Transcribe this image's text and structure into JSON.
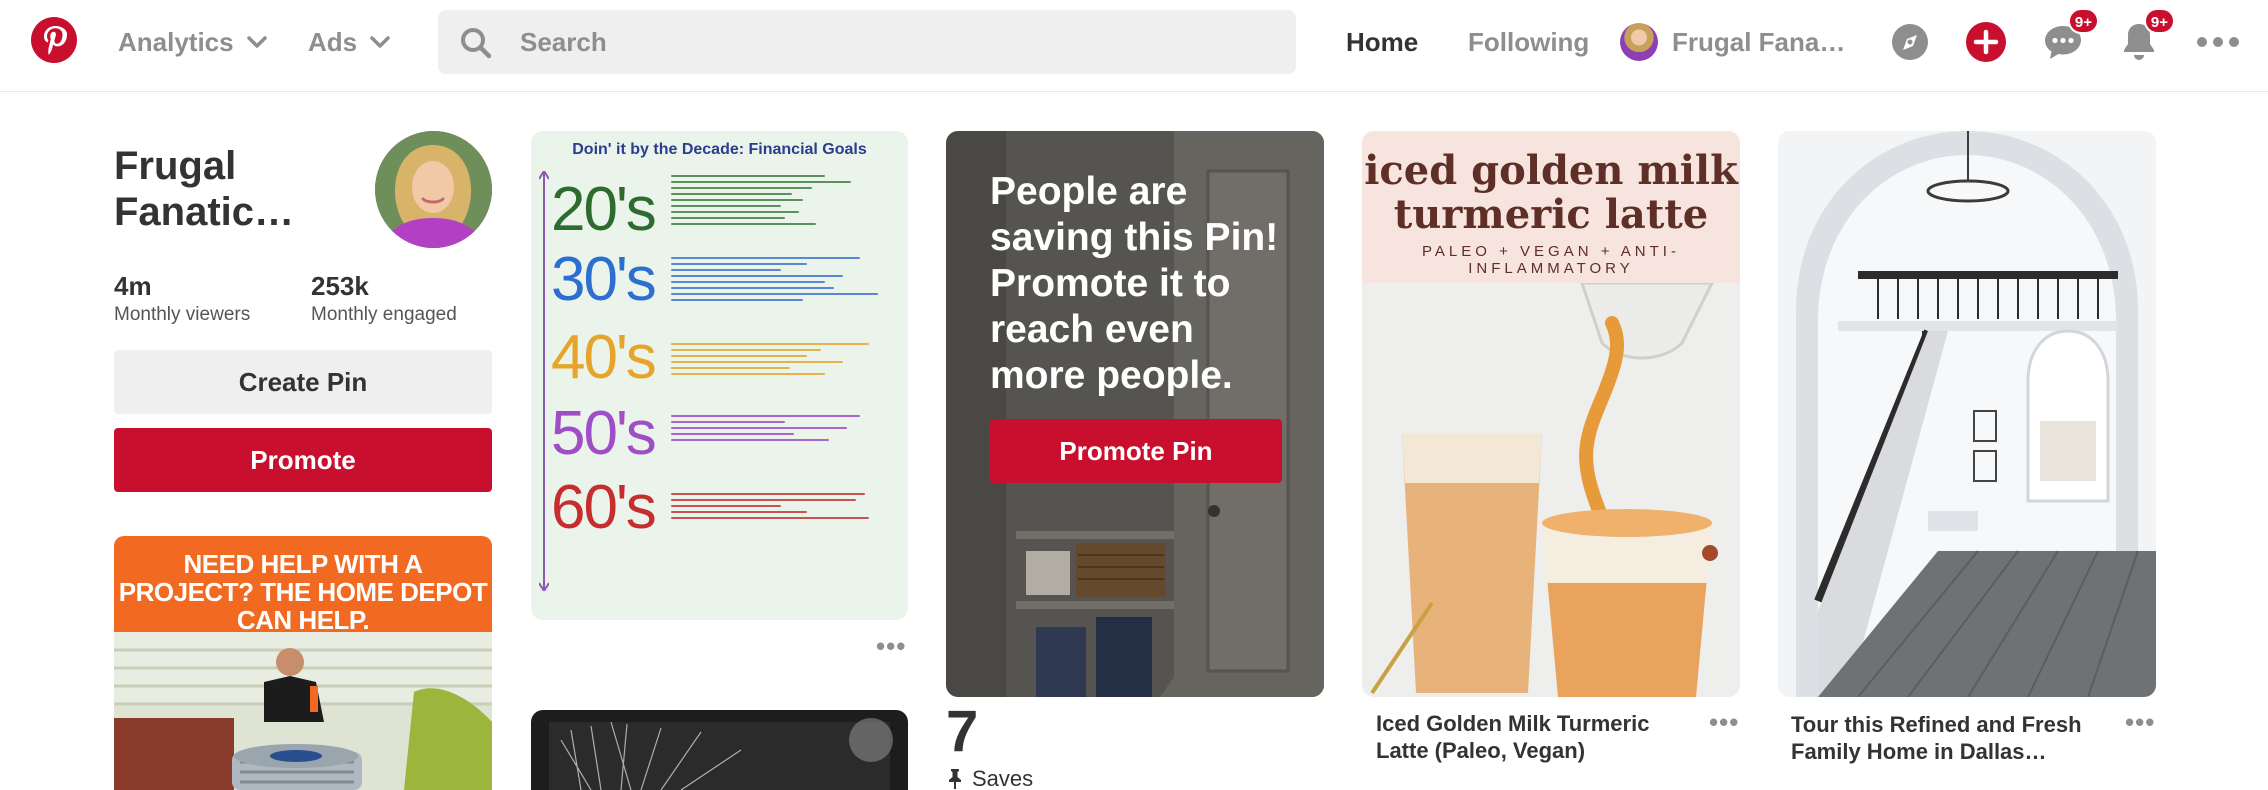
{
  "header": {
    "logo_icon": "pinterest-logo-icon",
    "analytics_label": "Analytics",
    "ads_label": "Ads",
    "search_placeholder": "Search",
    "home_label": "Home",
    "following_label": "Following",
    "profile_name": "Frugal Fana…",
    "explore_icon": "compass-icon",
    "create_icon": "plus-icon",
    "messages_icon": "speech-bubble-icon",
    "messages_badge": "9+",
    "notifications_icon": "bell-icon",
    "notifications_badge": "9+",
    "more_icon": "more-horizontal-icon",
    "brand_color": "#c8102e"
  },
  "profile": {
    "name": "Frugal Fanatic…",
    "monthly_viewers_value": "4m",
    "monthly_viewers_label": "Monthly viewers",
    "monthly_engaged_value": "253k",
    "monthly_engaged_label": "Monthly engaged",
    "create_pin_label": "Create Pin",
    "promote_label": "Promote"
  },
  "ad": {
    "headline": "NEED HELP WITH A PROJECT? THE HOME DEPOT CAN HELP."
  },
  "pins": {
    "finance": {
      "title": "Doin' it by the Decade: Financial Goals",
      "decades": [
        "20's",
        "30's",
        "40's",
        "50's",
        "60's"
      ],
      "decade_colors": [
        "#2e6b2e",
        "#2d6fd0",
        "#e6a52a",
        "#a04ec8",
        "#c62d2d"
      ]
    },
    "closet": {
      "headline": "People are saving this Pin! Promote it to reach even more people.",
      "promote_pin_label": "Promote Pin",
      "saves_count": "7",
      "saves_label": "Saves"
    },
    "latte": {
      "image_heading": "iced golden milk turmeric latte",
      "image_subheading": "PALEO + VEGAN + ANTI-INFLAMMATORY",
      "title": "Iced Golden Milk Turmeric Latte (Paleo, Vegan)"
    },
    "stair": {
      "title": "Tour this Refined and Fresh Family Home in Dallas…"
    }
  }
}
